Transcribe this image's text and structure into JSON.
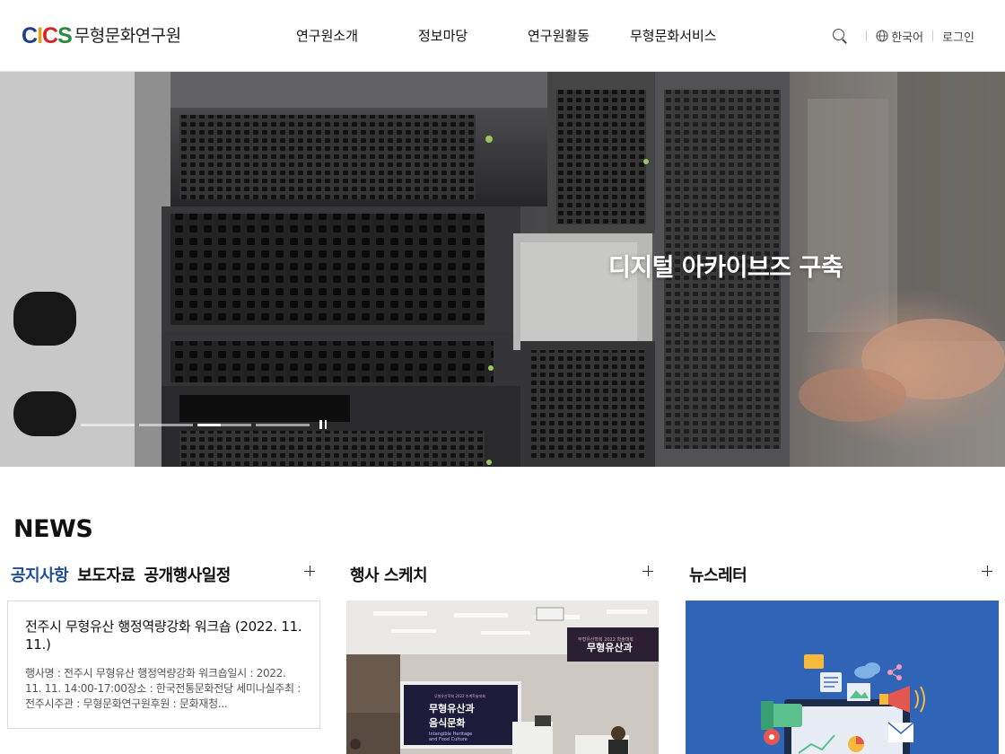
{
  "header": {
    "logo_mark": [
      "C",
      "I",
      "C",
      "S"
    ],
    "logo_name": "무형문화연구원",
    "nav": [
      "연구원소개",
      "정보마당",
      "연구원활동",
      "무형문화서비스"
    ],
    "language": "한국어",
    "login": "로그인"
  },
  "hero": {
    "caption": "디지털 아카이브즈 구축",
    "slide_count": 4,
    "active_slide": 3
  },
  "news": {
    "title": "NEWS",
    "notice_tabs": [
      "공지사항",
      "보도자료",
      "공개행사일정"
    ],
    "notice": {
      "title": "전주시 무형유산 행정역량강화 워크숍 (2022. 11. 11.)",
      "body": "행사명 : 전주시 무형유산 행정역량강화 워크숍일시 : 2022. 11. 11. 14:00-17:00장소 : 한국전통문화전당 세미나실주최 : 전주시주관 : 무형문화연구원후원 : 문화재청..."
    },
    "sketch_title": "행사 스케치",
    "sketch_image": {
      "banner_text": "무형유산과",
      "banner_small": "무형유산학회 2022 학술대회",
      "screen_title_1": "무형유산과",
      "screen_title_2": "음식문화",
      "screen_sub_1": "Intangible Heritage",
      "screen_sub_2": "and Food Culture",
      "screen_small": "무형유산학회 2022 추계학술대회"
    },
    "newsletter_title": "뉴스레터"
  },
  "colors": {
    "accent_blue": "#1f4e96",
    "logo_c": "#1d3d8f",
    "logo_i": "#e8a21b",
    "logo_c2": "#d3242b",
    "logo_s": "#2a8a3d",
    "newsletter_bg": "#2f64b7"
  },
  "icons": [
    "search-icon",
    "globe-icon",
    "pause-icon",
    "plus-icon"
  ]
}
